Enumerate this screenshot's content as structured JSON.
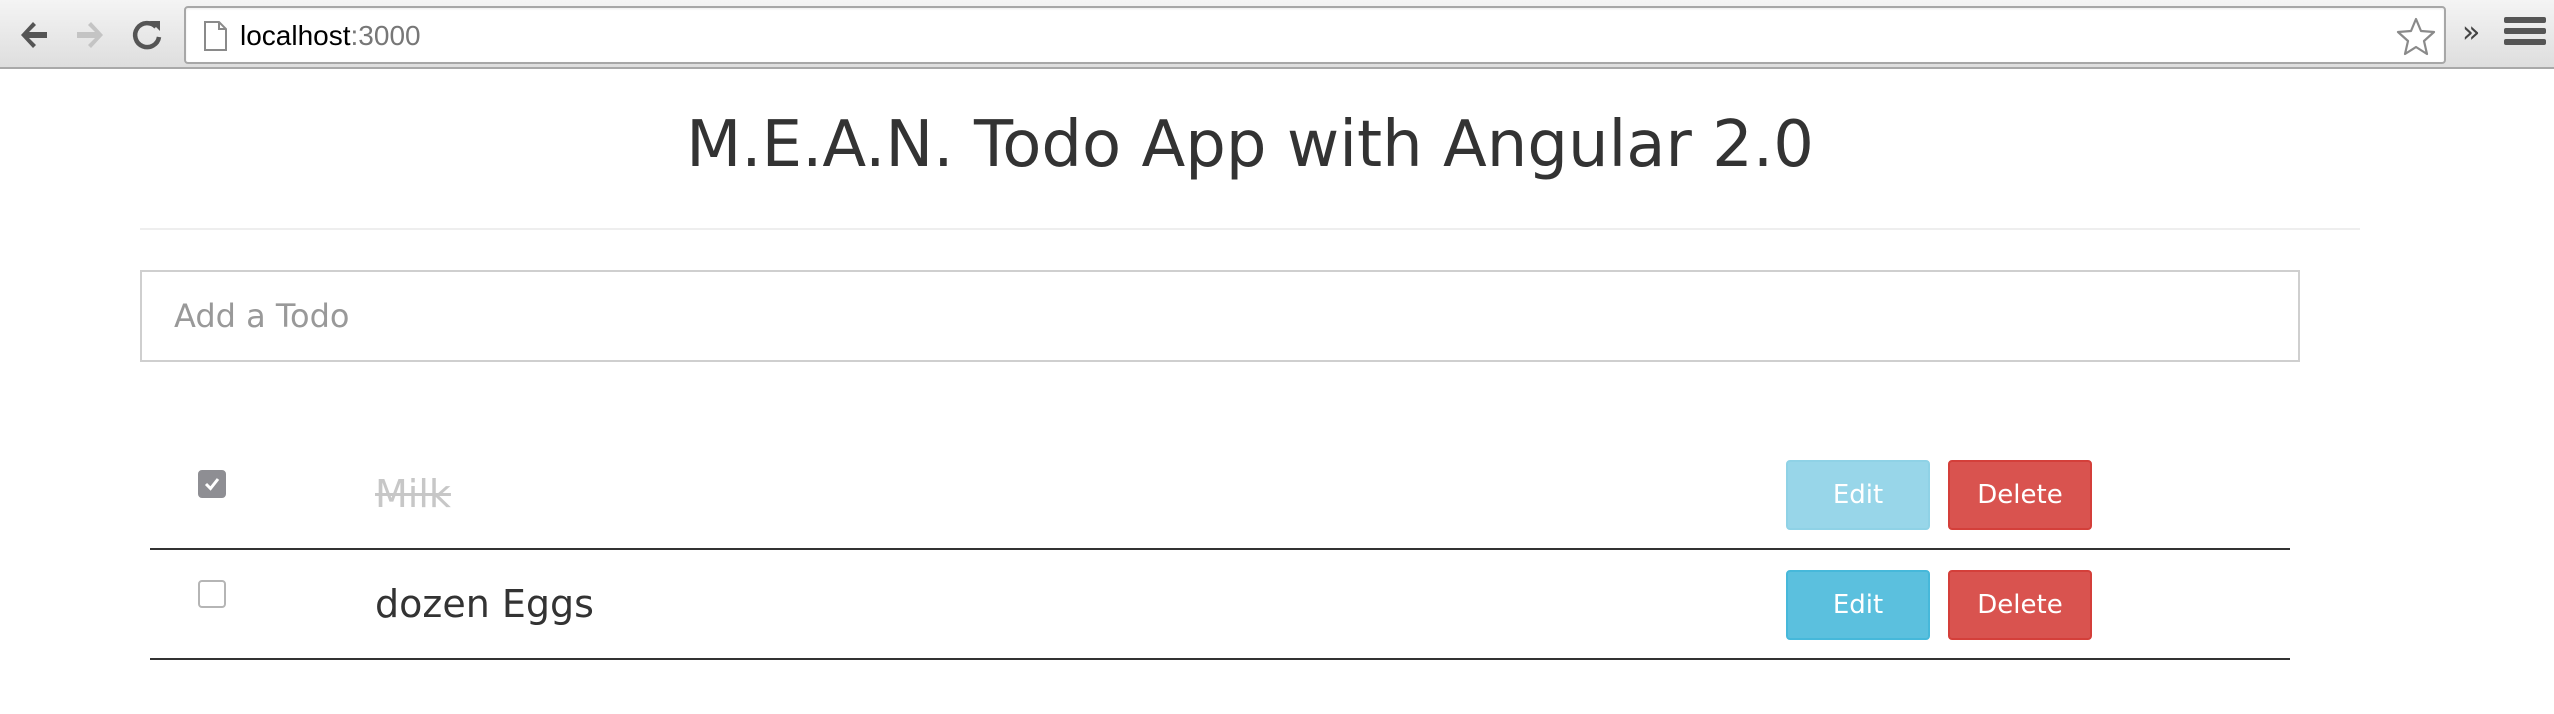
{
  "browser": {
    "url_host": "localhost",
    "url_port": ":3000",
    "icons": {
      "back": "back-arrow-icon",
      "forward": "forward-arrow-icon",
      "reload": "reload-icon",
      "page": "page-icon",
      "bookmark": "star-icon",
      "overflow": "double-chevron-icon",
      "menu": "hamburger-menu-icon"
    },
    "overflow_glyph": "»"
  },
  "page": {
    "title": "M.E.A.N. Todo App with Angular 2.0",
    "input_placeholder": "Add a Todo",
    "input_value": ""
  },
  "todos": [
    {
      "title": "Milk",
      "done": true,
      "edit_label": "Edit",
      "edit_disabled": true,
      "delete_label": "Delete"
    },
    {
      "title": "dozen Eggs",
      "done": false,
      "edit_label": "Edit",
      "edit_disabled": false,
      "delete_label": "Delete"
    }
  ],
  "colors": {
    "edit": "#5bc0de",
    "edit_disabled": "#98d6e9",
    "delete": "#d9534f",
    "done_text": "#c7c7c7"
  }
}
